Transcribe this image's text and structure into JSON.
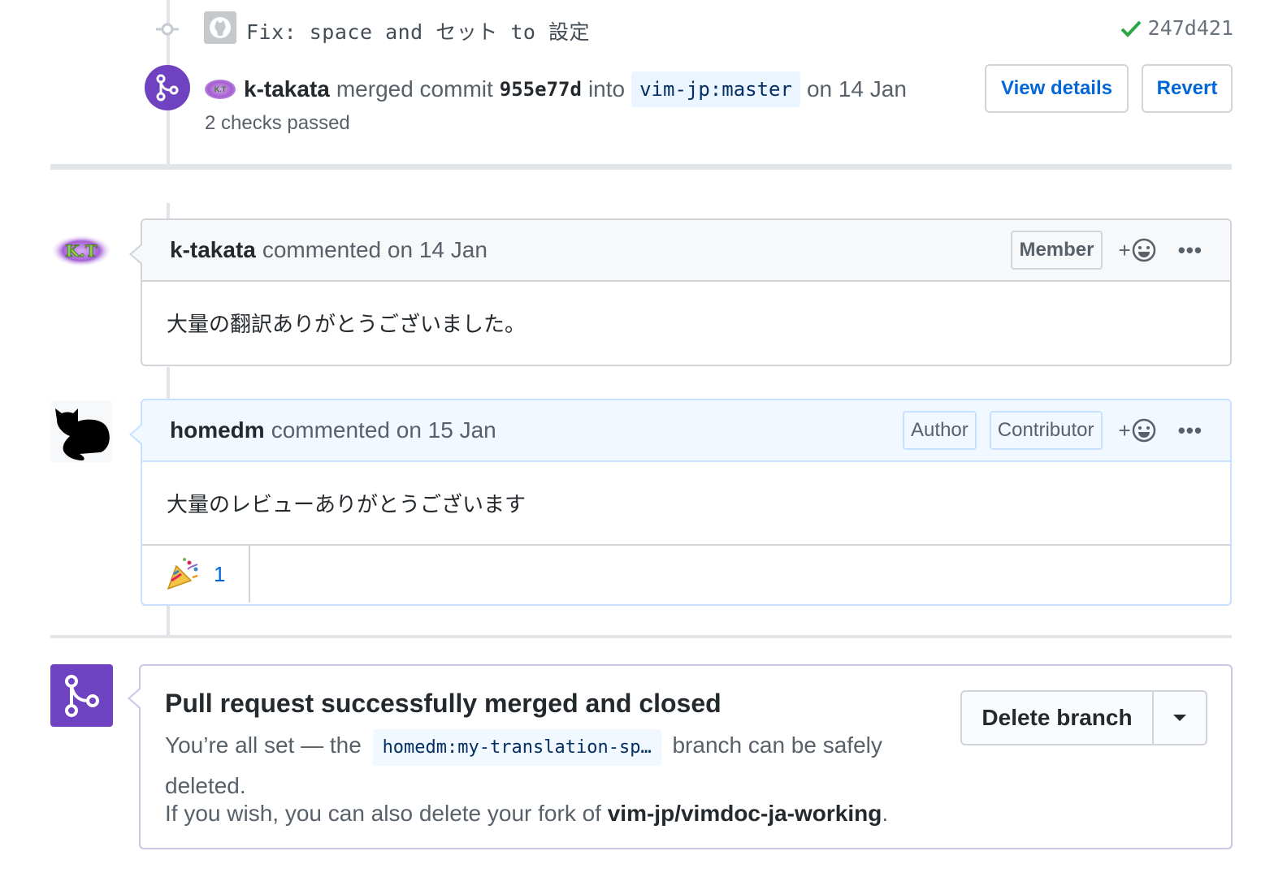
{
  "commit": {
    "message": "Fix: space and セット to 設定",
    "sha": "247d421",
    "status_color": "#28a745"
  },
  "merge_event": {
    "actor": "k-takata",
    "action": "merged commit",
    "commit_sha": "955e77d",
    "into": "into",
    "target_branch": "vim-jp:master",
    "date": "on 14 Jan",
    "checks": "2 checks passed",
    "view_details_label": "View details",
    "revert_label": "Revert",
    "avatar_text": "K.T"
  },
  "comments": [
    {
      "author": "k-takata",
      "timestamp": "commented on 14 Jan",
      "labels": [
        "Member"
      ],
      "body": "大量の翻訳ありがとうございました。",
      "add_reaction": "+",
      "more": "•••",
      "avatar_text": "K.T"
    },
    {
      "author": "homedm",
      "timestamp": "commented on 15 Jan",
      "labels": [
        "Author",
        "Contributor"
      ],
      "body": "大量のレビューありがとうございます",
      "add_reaction": "+",
      "more": "•••",
      "reactions": [
        {
          "icon": "tada-icon",
          "count": "1"
        }
      ]
    }
  ],
  "merged_status": {
    "title": "Pull request successfully merged and closed",
    "text_prefix": "You’re all set — the",
    "branch": "homedm:my-translation-sp…",
    "text_suffix": "branch can be safely deleted.",
    "fork_prefix": "If you wish, you can also delete your fork of",
    "fork_repo": "vim-jp/vimdoc-ja-working",
    "fork_suffix": ".",
    "delete_label": "Delete branch"
  },
  "colors": {
    "merged_purple": "#6f42c1",
    "link_blue": "#0366d6",
    "author_tint": "#f1f8ff"
  }
}
